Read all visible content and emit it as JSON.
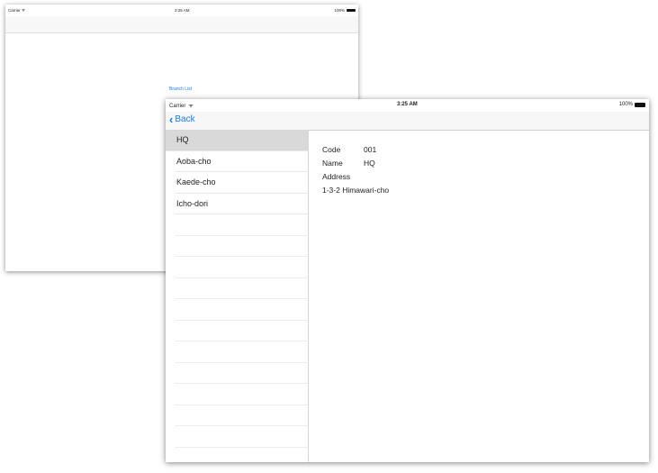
{
  "back_window": {
    "status": {
      "carrier": "Carrier ᯤ",
      "time": "3:25 AM",
      "battery": "100%"
    },
    "link": "Branch List"
  },
  "front_window": {
    "status": {
      "carrier": "Carrier",
      "time": "3:25 AM",
      "battery": "100%"
    },
    "nav": {
      "back_label": "Back"
    },
    "branches": [
      "HQ",
      "Aoba-cho",
      "Kaede-cho",
      "Icho-dori"
    ],
    "detail": {
      "code_label": "Code",
      "code_value": "001",
      "name_label": "Name",
      "name_value": "HQ",
      "address_label": "Address",
      "address_value": "1-3-2 Himawari-cho"
    }
  }
}
